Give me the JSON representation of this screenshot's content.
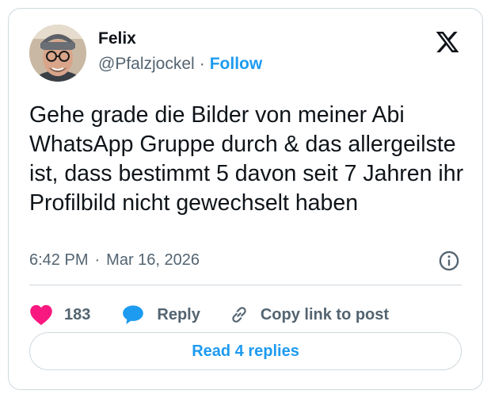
{
  "author": {
    "name": "Felix",
    "handle": "@Pfalzjockel",
    "separator": "·",
    "follow_label": "Follow"
  },
  "tweet": {
    "text": "Gehe grade die Bilder von meiner Abi WhatsApp Gruppe durch & das allergeilste ist, dass bestimmt 5 davon seit 7 Jahren ihr Profilbild nicht gewechselt haben",
    "time": "6:42 PM",
    "separator": "·",
    "date": "Mar 16, 2026"
  },
  "actions": {
    "like_count": "183",
    "reply_label": "Reply",
    "copy_label": "Copy link to post"
  },
  "read_replies_label": "Read 4 replies",
  "colors": {
    "like": "#f91880",
    "reply": "#1d9bf0",
    "link": "#1d9bf0",
    "muted": "#536471",
    "border": "#cfd9de"
  },
  "icons": {
    "brand": "x-logo-icon",
    "info": "info-icon",
    "like": "heart-icon",
    "reply": "speech-bubble-icon",
    "copy": "link-icon"
  }
}
